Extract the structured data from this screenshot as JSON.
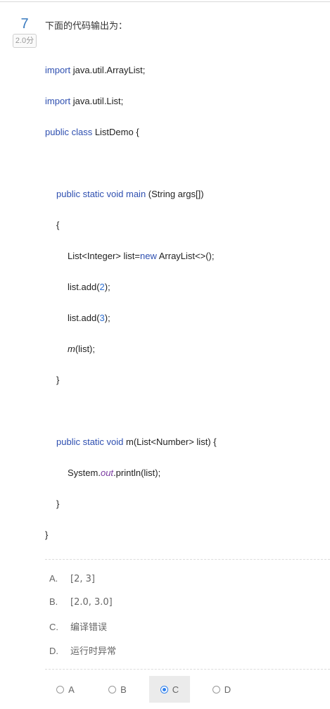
{
  "question": {
    "number": "7",
    "score": "2.0分",
    "title": "下面的代码输出为："
  },
  "code_lines": [
    {
      "k1": "import",
      "t1": " java.util.ArrayList;"
    },
    {
      "k1": "import",
      "t1": " java.util.List;"
    },
    {
      "k1": "public class",
      "t1": " ListDemo {"
    },
    {
      "k1": "public static void main",
      "t1": " (String args[])"
    },
    {
      "t1": "{"
    },
    {
      "a": "List<Integer> list=",
      "b": "new",
      "c": " ArrayList<>();"
    },
    {
      "a": "list.add(",
      "b": "2",
      "c": ");"
    },
    {
      "a": "list.add(",
      "b": "3",
      "c": ");"
    },
    {
      "a": "m",
      "c": "(list);"
    },
    {
      "t1": "}"
    },
    {
      "k1": "public static void",
      "t1": " m(List<Number> list) {"
    },
    {
      "a": "System.",
      "b": "out",
      "c": ".println(list);"
    },
    {
      "t1": "}"
    },
    {
      "t1": "}"
    }
  ],
  "options": [
    {
      "letter": "A.",
      "text": "[2, 3]"
    },
    {
      "letter": "B.",
      "text": "[2.0, 3.0]"
    },
    {
      "letter": "C.",
      "text": "编译错误"
    },
    {
      "letter": "D.",
      "text": "运行时异常"
    }
  ],
  "answer_choices": [
    {
      "label": "A",
      "selected": false
    },
    {
      "label": "B",
      "selected": false
    },
    {
      "label": "C",
      "selected": true
    },
    {
      "label": "D",
      "selected": false
    }
  ],
  "colors": {
    "keyword": "#2e4fb0",
    "number": "#2e6fd0",
    "field": "#7a3aa0",
    "radio_selected": "#2f80ed"
  }
}
